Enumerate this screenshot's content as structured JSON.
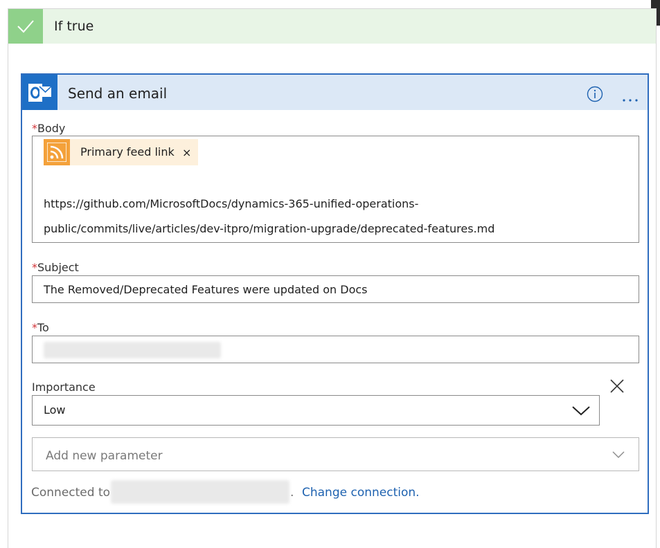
{
  "condition": {
    "title": "If true"
  },
  "action": {
    "title": "Send an email",
    "fields": {
      "body": {
        "label": "Body",
        "required_mark": "*",
        "token_label": "Primary feed link",
        "token_remove": "×",
        "url_line1": "https://github.com/MicrosoftDocs/dynamics-365-unified-operations-",
        "url_line2": "public/commits/live/articles/dev-itpro/migration-upgrade/deprecated-features.md"
      },
      "subject": {
        "label": "Subject",
        "required_mark": "*",
        "value": "The Removed/Deprecated Features were updated on Docs"
      },
      "to": {
        "label": "To",
        "required_mark": "*",
        "value": ""
      },
      "importance": {
        "label": "Importance",
        "value": "Low"
      }
    },
    "add_parameter": {
      "placeholder": "Add new parameter"
    },
    "connection": {
      "prefix": "Connected to",
      "suffix": ".",
      "account": "",
      "change_link": "Change connection."
    }
  },
  "colors": {
    "accent": "#2f6dbf",
    "header_bg": "#dce8f6",
    "success_bg": "#e8f5e6",
    "success_tile": "#8fd18a",
    "token_bg": "#fdf0dc",
    "rss_orange": "#f4a13a",
    "required": "#d13438",
    "link": "#1e62b0"
  },
  "icons": [
    "checkmark-icon",
    "outlook-icon",
    "info-icon",
    "more-options-icon",
    "rss-icon",
    "close-icon",
    "chevron-down-icon"
  ]
}
